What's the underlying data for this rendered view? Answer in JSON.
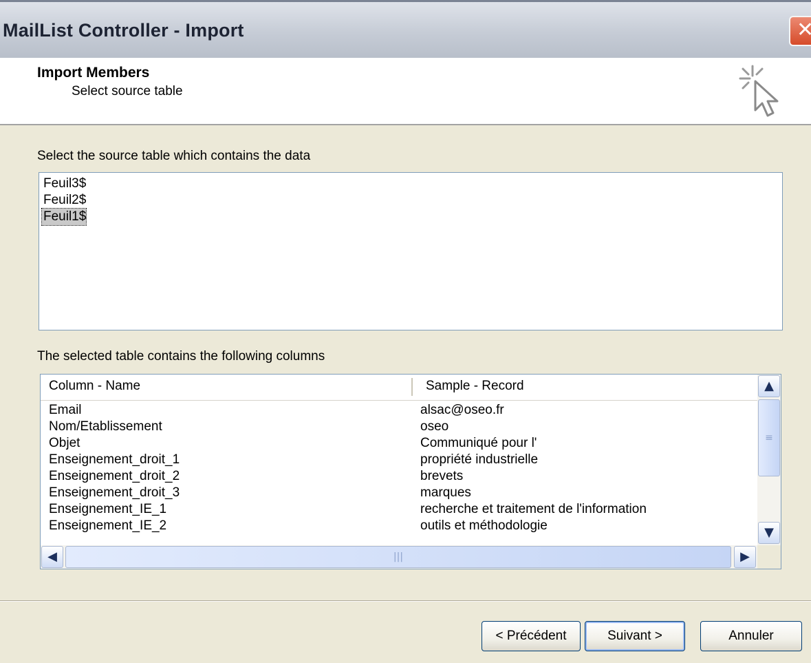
{
  "window": {
    "title": "MailList Controller - Import",
    "close_label": "✕"
  },
  "header": {
    "title": "Import Members",
    "subtitle": "Select source table"
  },
  "tables": {
    "label": "Select the source table which contains the data",
    "items": [
      "Feuil3$",
      "Feuil2$",
      "Feuil1$"
    ],
    "selected": "Feuil1$"
  },
  "columns": {
    "label": "The selected table contains the following columns",
    "headers": [
      "Column - Name",
      "Sample - Record"
    ],
    "rows": [
      [
        "Email",
        "alsac@oseo.fr"
      ],
      [
        "Nom/Etablissement",
        "oseo"
      ],
      [
        "Objet",
        "Communiqué pour l'"
      ],
      [
        "Enseignement_droit_1",
        "propriété industrielle"
      ],
      [
        "Enseignement_droit_2",
        "brevets"
      ],
      [
        "Enseignement_droit_3",
        "marques"
      ],
      [
        "Enseignement_IE_1",
        "recherche et traitement de l'information"
      ],
      [
        "Enseignement_IE_2",
        "outils et méthodologie"
      ]
    ]
  },
  "buttons": {
    "previous": "< Précédent",
    "next": "Suivant >",
    "cancel": "Annuler"
  },
  "icons": {
    "wizard": "cursor-sparkle-icon",
    "close": "close-icon",
    "scroll_up": "arrow-up-icon",
    "scroll_down": "arrow-down-icon",
    "scroll_left": "arrow-left-icon",
    "scroll_right": "arrow-right-icon"
  },
  "colors": {
    "accent": "#003c74",
    "selection": "#c9c9c9",
    "close": "#d64b2a"
  }
}
